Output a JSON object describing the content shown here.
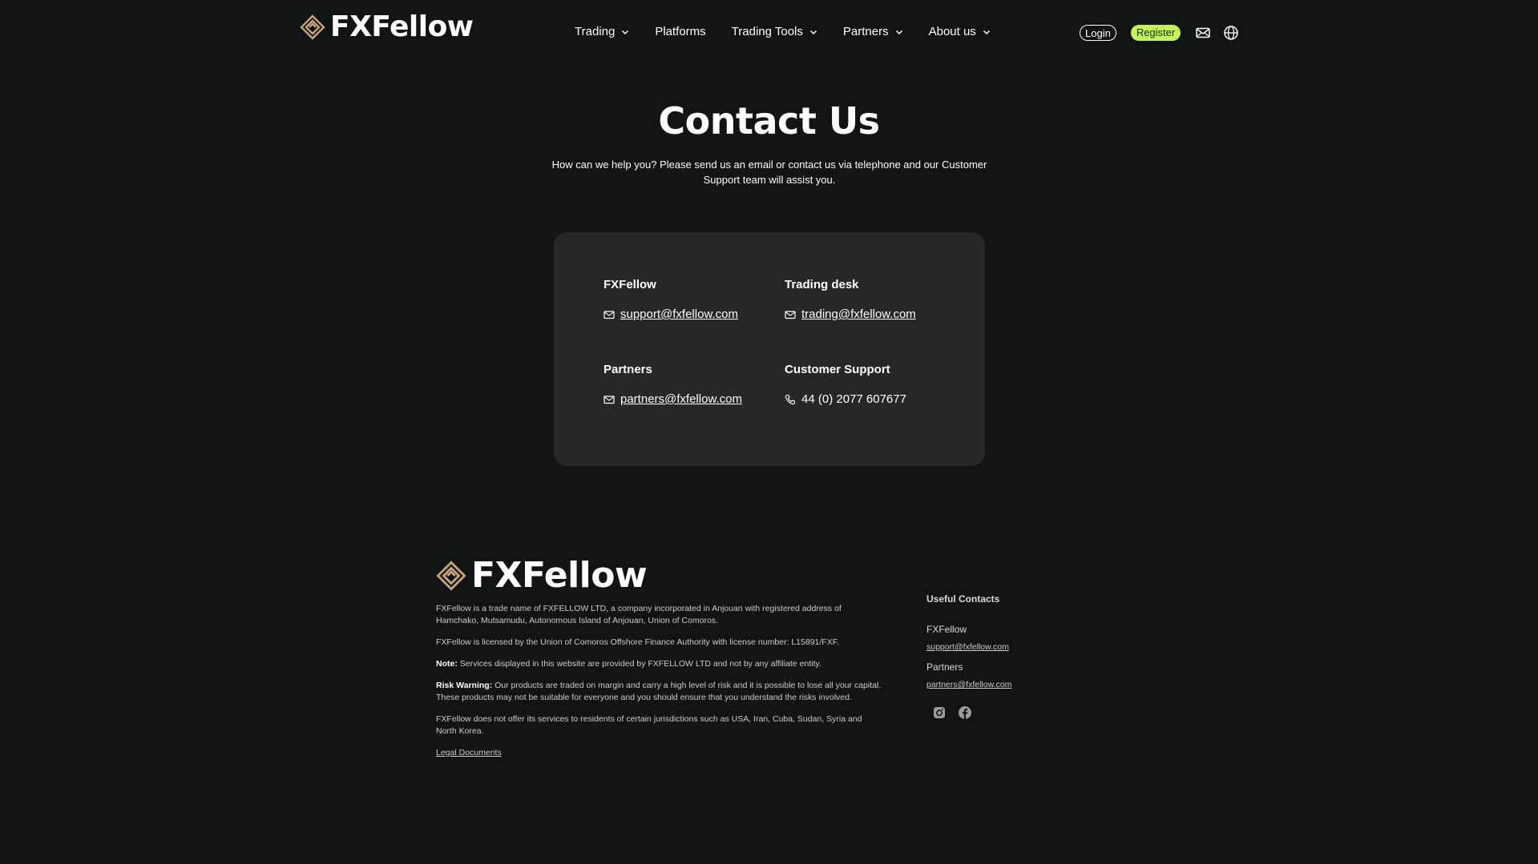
{
  "brand": {
    "name": "FXFellow",
    "logo_color": "#c8a27a"
  },
  "nav": {
    "items": [
      {
        "label": "Trading",
        "dropdown": true,
        "icon": "chevron-down-icon"
      },
      {
        "label": "Platforms",
        "dropdown": false
      },
      {
        "label": "Trading Tools",
        "dropdown": true,
        "icon": "chevron-down-icon"
      },
      {
        "label": "Partners",
        "dropdown": true,
        "icon": "chevron-down-icon"
      },
      {
        "label": "About us",
        "dropdown": true,
        "icon": "chevron-down-icon"
      }
    ]
  },
  "header": {
    "login_label": "Login",
    "register_label": "Register",
    "mail_icon": "mail-icon",
    "language_icon": "globe-icon",
    "register_color": "#c4f35a"
  },
  "hero": {
    "title": "Contact Us",
    "subtitle": "How can we help you? Please send us an email or contact us via telephone and our Customer Support team will assist you."
  },
  "contacts": [
    {
      "title": "FXFellow",
      "value": "support@fxfellow.com",
      "icon": "mail-icon",
      "link": true
    },
    {
      "title": "Trading desk",
      "value": "trading@fxfellow.com",
      "icon": "mail-icon",
      "link": true
    },
    {
      "title": "Partners",
      "value": "partners@fxfellow.com",
      "icon": "mail-icon",
      "link": true
    },
    {
      "title": "Customer Support",
      "value": "44 (0) 2077 607677",
      "icon": "phone-icon",
      "link": false
    }
  ],
  "footer": {
    "paragraphs": {
      "company": "FXFellow is a trade name of FXFELLOW LTD, a company incorporated in Anjouan with registered address of Hamchako, Mutsamudu, Autonomous Island of Anjouan, Union of Comoros.",
      "license": "FXFellow is licensed by the Union of Comoros Offshore Finance Authority with license number: L15891/FXF.",
      "note_label": "Note:",
      "note_text": " Services displayed in this website are provided by FXFELLOW LTD and not by any affiliate entity.",
      "risk_label": "Risk Warning:",
      "risk_text": " Our products are traded on margin and carry a high level of risk and it is possible to lose all your capital. These products may not be suitable for everyone and you should ensure that you understand the risks involved.",
      "jurisdictions": "FXFellow does not offer its services to residents of certain jurisdictions such as USA, Iran, Cuba, Sudan, Syria and North Korea.",
      "legal_link": "Legal Documents"
    },
    "useful": {
      "title": "Useful Contacts",
      "items": [
        {
          "name": "FXFellow",
          "email": "support@fxfellow.com"
        },
        {
          "name": "Partners",
          "email": "partners@fxfellow.com"
        }
      ],
      "social": [
        "instagram-icon",
        "facebook-icon"
      ]
    }
  }
}
